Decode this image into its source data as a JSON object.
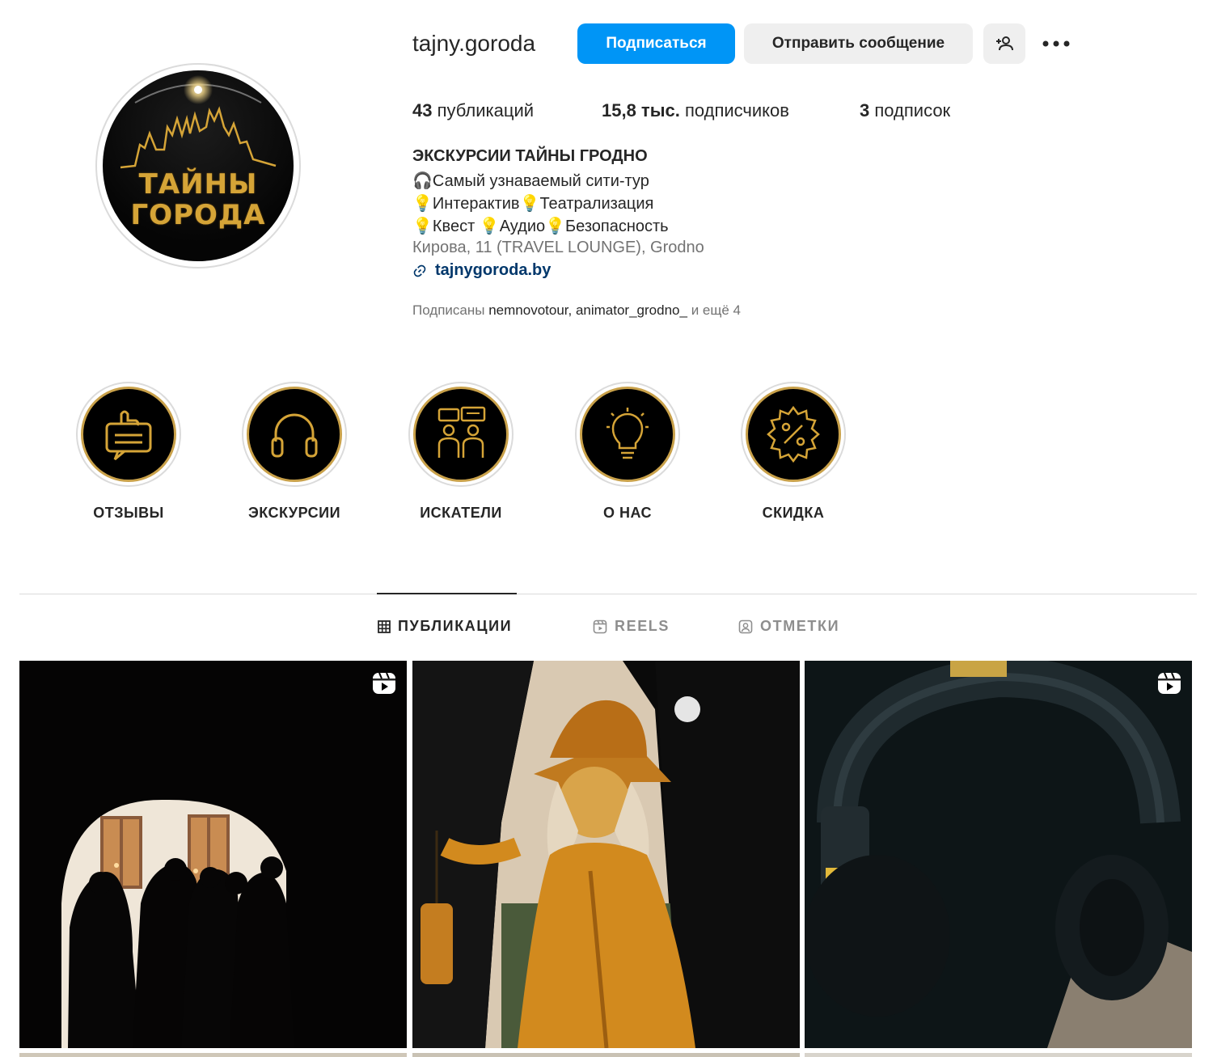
{
  "profile": {
    "username": "tajny.goroda",
    "avatar_text_line1": "ТАЙНЫ",
    "avatar_text_line2": "ГОРОДА",
    "follow_label": "Подписаться",
    "message_label": "Отправить сообщение",
    "add_user_icon": "person-add-icon",
    "more_icon": "more-options-icon"
  },
  "stats": {
    "posts_count": "43",
    "posts_label": "публикаций",
    "followers_count": "15,8 тыс.",
    "followers_label": "подписчиков",
    "following_count": "3",
    "following_label": "подписок"
  },
  "bio": {
    "name": "ЭКСКУРСИИ ТАЙНЫ ГРОДНО",
    "line1": "🎧Самый узнаваемый сити-тур",
    "line2": "💡Интерактив💡Театрализация",
    "line3": "💡Квест 💡Аудио💡Безопасность",
    "location": "Кирова, 11 (TRAVEL LOUNGE), Grodno",
    "link": "tajnygoroda.by",
    "followed_by_prefix": "Подписаны",
    "followed_by_users": "nemnovotour, animator_grodno_",
    "followed_by_suffix": "и ещё 4"
  },
  "highlights": [
    {
      "label": "ОТЗЫВЫ",
      "icon": "review-thumbs-up-icon"
    },
    {
      "label": "ЭКСКУРСИИ",
      "icon": "headphones-icon"
    },
    {
      "label": "ИСКАТЕЛИ",
      "icon": "people-chat-icon"
    },
    {
      "label": "О НАС",
      "icon": "lightbulb-icon"
    },
    {
      "label": "СКИДКА",
      "icon": "discount-badge-icon"
    }
  ],
  "tabs": [
    {
      "label": "ПУБЛИКАЦИИ",
      "icon": "grid-icon",
      "active": true
    },
    {
      "label": "REELS",
      "icon": "reels-icon",
      "active": false
    },
    {
      "label": "ОТМЕТКИ",
      "icon": "tagged-icon",
      "active": false
    }
  ],
  "posts": [
    {
      "type": "reel",
      "description_icon": "reel-icon"
    },
    {
      "type": "photo"
    },
    {
      "type": "reel",
      "description_icon": "reel-icon"
    }
  ],
  "colors": {
    "accent_blue": "#0095f6",
    "link_blue": "#00376b",
    "gold": "#d5a437",
    "text": "#262626",
    "muted": "#737373"
  }
}
